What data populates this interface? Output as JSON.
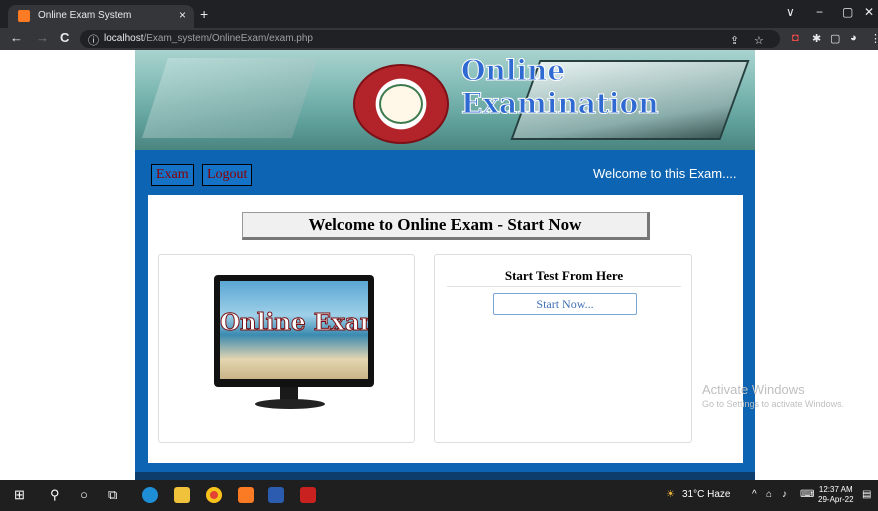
{
  "browser": {
    "tab_title": "Online Exam System",
    "tab_close": "×",
    "new_tab": "+",
    "url_host": "localhost",
    "url_path": "/Exam_system/OnlineExam/exam.php",
    "back_icon": "←",
    "forward_icon": "→",
    "reload_icon": "C",
    "info_icon": "ⓘ",
    "window_controls": [
      "∨",
      "−",
      "▢",
      "✕"
    ]
  },
  "banner": {
    "title": "Online Examination"
  },
  "nav": {
    "exam": "Exam",
    "logout": "Logout",
    "welcome": "Welcome to this Exam...."
  },
  "main": {
    "welcome_heading": "Welcome to Online Exam - Start Now",
    "image_text": "Online Exam",
    "start_heading": "Start Test From Here",
    "start_button": "Start Now..."
  },
  "watermark": {
    "title": "Activate Windows",
    "subtitle": "Go to Settings to activate Windows."
  },
  "taskbar": {
    "weather": "31°C  Haze",
    "time": "12:37 AM",
    "date": "29-Apr-22"
  },
  "colors": {
    "page_blue": "#0d64b2",
    "nav_link_text": "#8b0000",
    "taskbar": "#1f1f1f",
    "browser_chrome": "#202124"
  }
}
